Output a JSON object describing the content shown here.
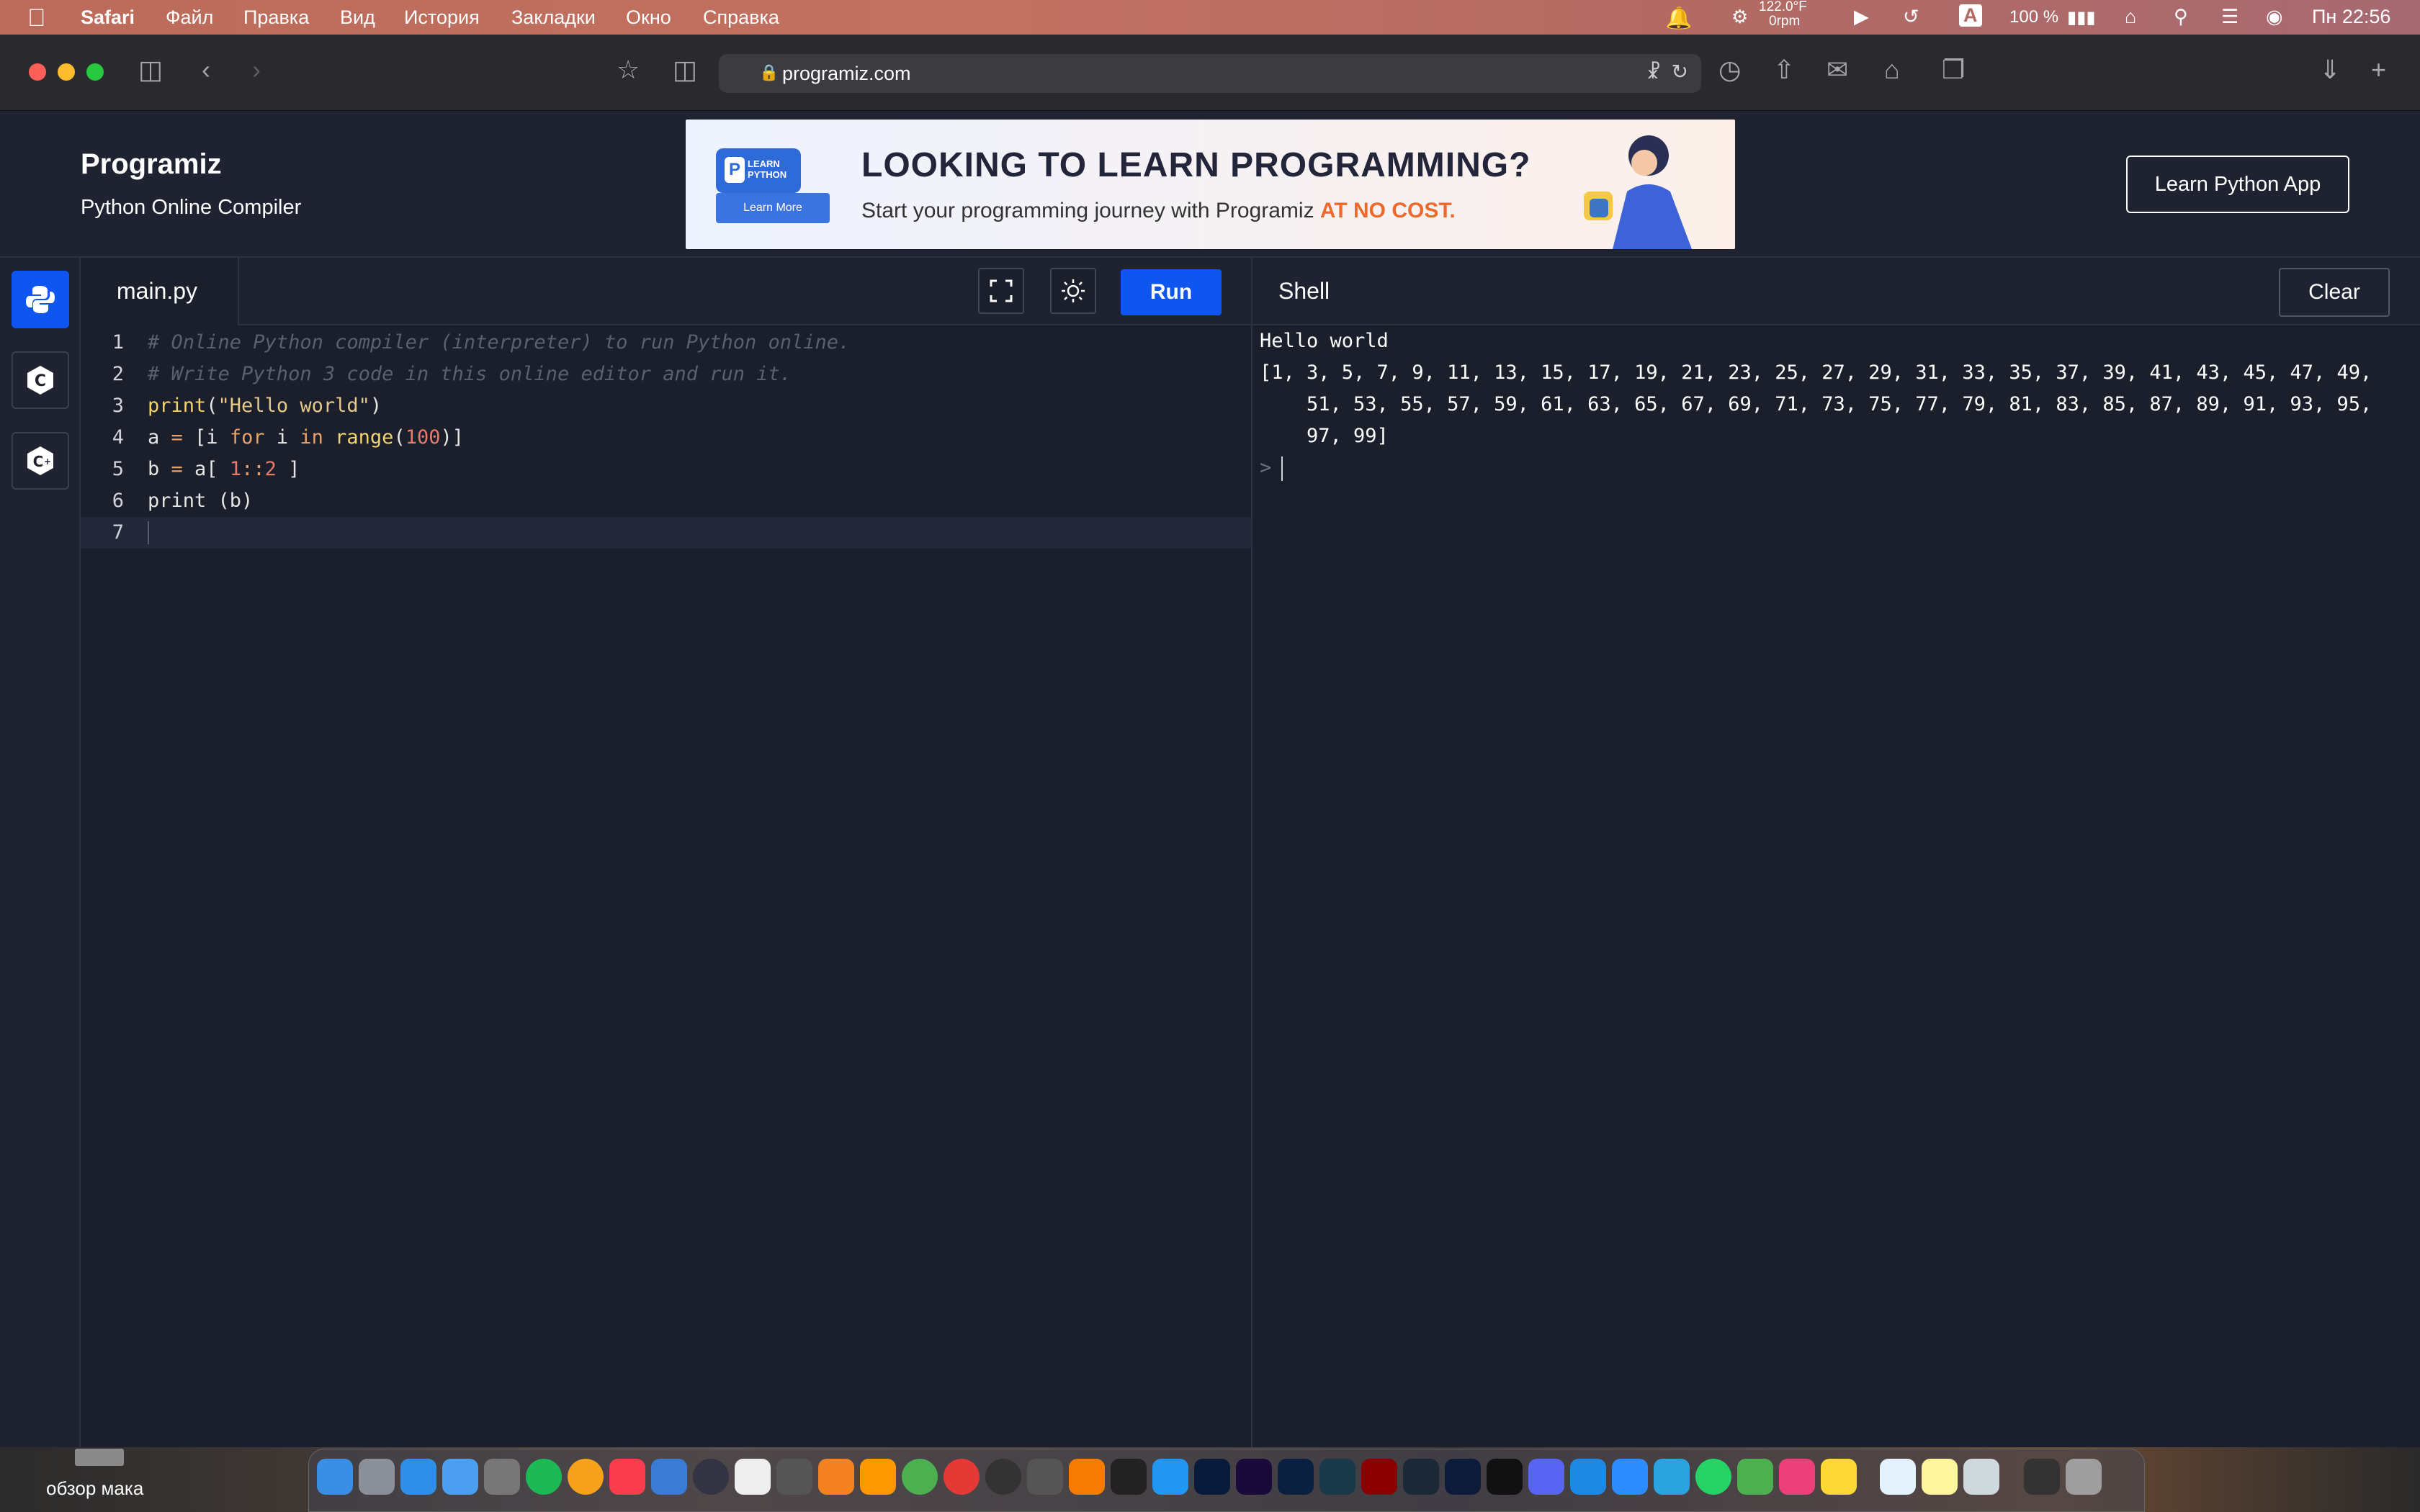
{
  "menubar": {
    "app": "Safari",
    "items": [
      "Файл",
      "Правка",
      "Вид",
      "История",
      "Закладки",
      "Окно",
      "Справка"
    ],
    "weather_temp": "122.0°F",
    "weather_sub": "0rpm",
    "input_lang": "A",
    "battery": "100 %",
    "clock": "Пн 22:56"
  },
  "browser": {
    "url": "programiz.com"
  },
  "header": {
    "logo": "Programiz",
    "subtitle": "Python Online Compiler",
    "learn_app_button": "Learn Python App",
    "ad": {
      "badge": "LEARN PYTHON",
      "badge_icon": "P",
      "learn_more": "Learn More",
      "headline": "LOOKING TO LEARN PROGRAMMING?",
      "sub_prefix": "Start your programming journey with Programiz ",
      "sub_highlight": "AT NO COST."
    }
  },
  "editor": {
    "file_tab": "main.py",
    "run_label": "Run",
    "lines": [
      {
        "n": "1"
      },
      {
        "n": "2"
      },
      {
        "n": "3"
      },
      {
        "n": "4"
      },
      {
        "n": "5"
      },
      {
        "n": "6"
      },
      {
        "n": "7"
      }
    ],
    "code": {
      "l1": "# Online Python compiler (interpreter) to run Python online.",
      "l2": "# Write Python 3 code in this online editor and run it.",
      "l3_fn": "print",
      "l3_open": "(",
      "l3_str": "\"Hello world\"",
      "l3_close": ")",
      "l4_a": "a ",
      "l4_eq": "=",
      "l4_b": " [i ",
      "l4_for": "for",
      "l4_c": " i ",
      "l4_in": "in",
      "l4_d": " ",
      "l4_range": "range",
      "l4_e": "(",
      "l4_num": "100",
      "l4_f": ")]",
      "l5_a": "b ",
      "l5_eq": "=",
      "l5_b": " a[ ",
      "l5_n1": "1",
      "l5_c": "::",
      "l5_n2": "2",
      "l5_d": " ]",
      "l6": "print (b)"
    }
  },
  "shell": {
    "title": "Shell",
    "clear_label": "Clear",
    "out1": "Hello world",
    "out2": "[1, 3, 5, 7, 9, 11, 13, 15, 17, 19, 21, 23, 25, 27, 29, 31, 33, 35, 37, 39, 41, 43, 45, 47, 49,",
    "out3": "    51, 53, 55, 57, 59, 61, 63, 65, 67, 69, 71, 73, 75, 77, 79, 81, 83, 85, 87, 89, 91, 93, 95,",
    "out4": "    97, 99]",
    "prompt": ">"
  },
  "desktop": {
    "folder_label": "обзор мака"
  },
  "colors": {
    "run": "#0f56f0",
    "bg": "#1b1e2b",
    "panel": "#1f2230"
  }
}
